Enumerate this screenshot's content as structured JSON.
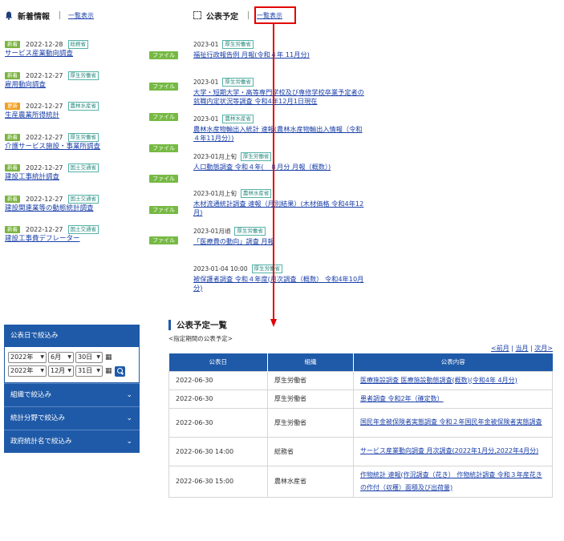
{
  "news": {
    "title": "新着情報",
    "all_label": "一覧表示",
    "file_label": "ファイル",
    "items": [
      {
        "badge": "新着",
        "badge_type": "new",
        "date": "2022-12-28",
        "org": "総務省",
        "title": "サービス産業動向調査"
      },
      {
        "badge": "新着",
        "badge_type": "new",
        "date": "2022-12-27",
        "org": "厚生労働省",
        "title": "雇用動向調査"
      },
      {
        "badge": "更新",
        "badge_type": "upd",
        "date": "2022-12-27",
        "org": "農林水産省",
        "title": "生産農業所得統計"
      },
      {
        "badge": "新着",
        "badge_type": "new",
        "date": "2022-12-27",
        "org": "厚生労働省",
        "title": "介護サービス施設・事業所調査"
      },
      {
        "badge": "新着",
        "badge_type": "new",
        "date": "2022-12-27",
        "org": "国土交通省",
        "title": "建設工事統計調査"
      },
      {
        "badge": "新着",
        "badge_type": "new",
        "date": "2022-12-27",
        "org": "国土交通省",
        "title": "建設関連業等の動態統計調査"
      },
      {
        "badge": "新着",
        "badge_type": "new",
        "date": "2022-12-27",
        "org": "国土交通省",
        "title": "建設工事費デフレーター"
      }
    ]
  },
  "schedule": {
    "title": "公表予定",
    "all_label": "一覧表示",
    "items": [
      {
        "date": "2023-01",
        "org": "厚生労働省",
        "title": "福祉行政報告例 月報(令和４年 11月分)"
      },
      {
        "date": "2023-01",
        "org": "厚生労働省",
        "title": "大学・短期大学・高等専門学校及び専修学校卒業予定者の就職内定状況等調査 令和4年12月1日現在"
      },
      {
        "date": "2023-01",
        "org": "農林水産省",
        "title": "農林水産物輸出入統計 速報(農林水産物輸出入情報（令和４年11月分）)"
      },
      {
        "date": "2023-01月上旬",
        "org": "厚生労働省",
        "title": "人口動態調査 令和４年(　８月分 月報（概数）)"
      },
      {
        "date": "2023-01月上旬",
        "org": "農林水産省",
        "title": "木材流通統計調査 速報（月別結果）(木材価格 令和4年12月)"
      },
      {
        "date": "2023-01月頃",
        "org": "厚生労働省",
        "title": "「医療費の動向」調査 月報"
      },
      {
        "date": "2023-01-04 10:00",
        "org": "厚生労働省",
        "title": "被保護者調査 令和４年度(月次調査（概数） 令和4年10月分)"
      }
    ]
  },
  "filter": {
    "date_label": "公表日で絞込み",
    "from": {
      "year": "2022年",
      "month": "6月",
      "day": "30日"
    },
    "to": {
      "year": "2022年",
      "month": "12月",
      "day": "31日"
    },
    "accordions": [
      "組織で絞込み",
      "統計分野で絞込み",
      "政府統計名で絞込み"
    ]
  },
  "list": {
    "title": "公表予定一覧",
    "subtitle": "<指定期間の公表予定>",
    "pager": {
      "prev": "<前月",
      "current": "当月",
      "next": "次月>"
    },
    "columns": [
      "公表日",
      "組織",
      "公表内容"
    ],
    "rows": [
      {
        "date": "2022-06-30",
        "org": "厚生労働省",
        "content": "医療施設調査 医療施設動態調査(概数)(令和4年 4月分)"
      },
      {
        "date": "2022-06-30",
        "org": "厚生労働省",
        "content": "患者調査 令和2年（確定数）"
      },
      {
        "date": "2022-06-30",
        "org": "厚生労働省",
        "content": "国民年金被保険者実態調査 令和２年国民年金被保険者実態調査"
      },
      {
        "date": "2022-06-30 14:00",
        "org": "総務省",
        "content": "サービス産業動向調査 月次調査(2022年1月分,2022年4月分)"
      },
      {
        "date": "2022-06-30 15:00",
        "org": "農林水産省",
        "content": "作物統計 速報(作況調査（花き） 作物統計調査 令和３年産花きの作付（収穫）面積及び出荷量)"
      }
    ]
  },
  "colors": {
    "primary": "#1f5aa8",
    "link": "#1a3fa8",
    "new_badge": "#7cb342",
    "update_badge": "#f0a020",
    "highlight": "#e20000"
  }
}
